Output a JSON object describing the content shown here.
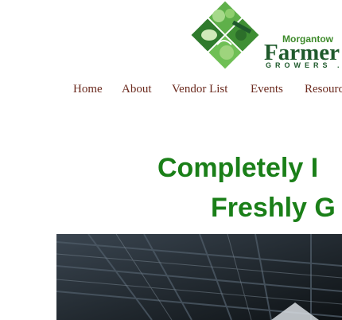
{
  "logo": {
    "line1": "Morgantow",
    "line2": "Farmer",
    "line3": "GROWERS  ."
  },
  "nav": {
    "items": [
      "Home",
      "About",
      "Vendor List",
      "Events",
      "Resourc"
    ]
  },
  "hero": {
    "line1": "Completely I",
    "line2": "Freshly G"
  },
  "colors": {
    "nav_text": "#6b2a1e",
    "headline": "#1a7f18",
    "logo_dark_green": "#1f5a2c",
    "logo_light_green": "#3d8a2a"
  }
}
